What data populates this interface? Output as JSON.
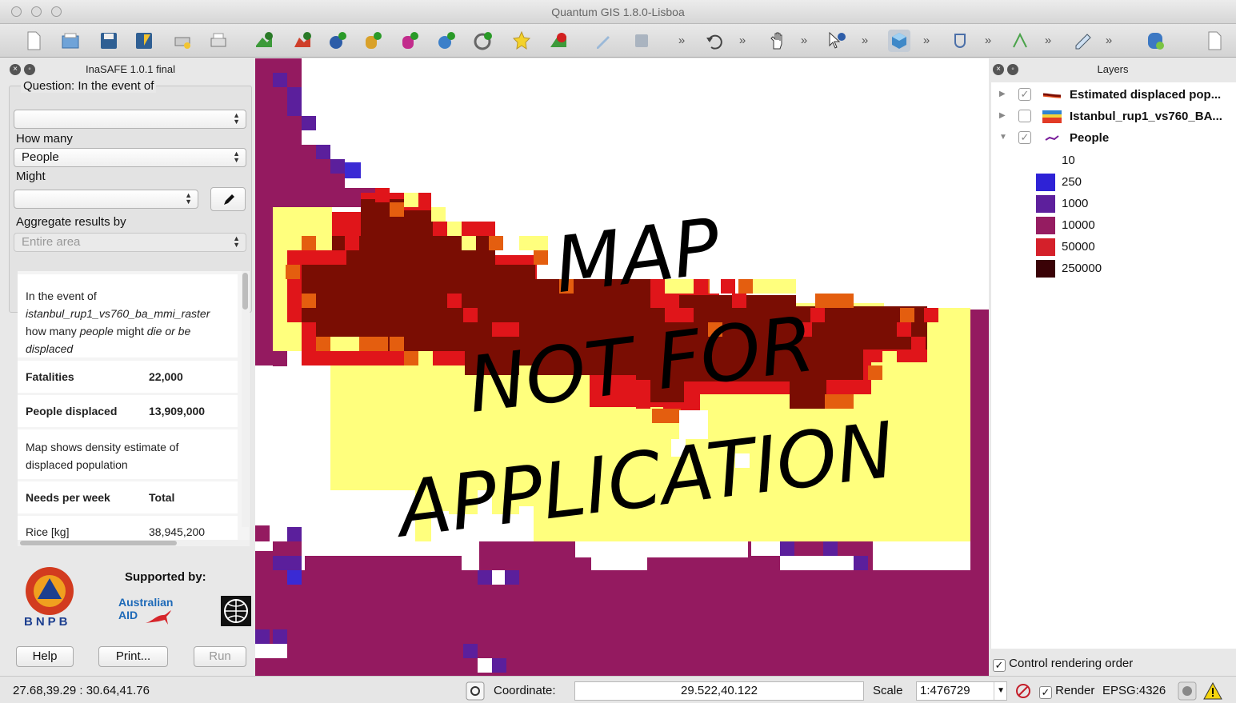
{
  "window": {
    "title": "Quantum GIS 1.8.0-Lisboa"
  },
  "inasafe": {
    "title": "InaSAFE 1.0.1 final",
    "question_label": "Question: In the event of",
    "hazard_value": "",
    "how_many_label": "How many",
    "exposure_value": "People",
    "might_label": "Might",
    "impact_value": "",
    "aggregate_label": "Aggregate results by",
    "aggregate_value": "Entire area",
    "results": {
      "intro_prefix": "In the event of",
      "hazard_name": "istanbul_rup1_vs760_ba_mmi_raster",
      "how_many": "how many",
      "people_word": "people",
      "might": "might",
      "die_or_be": "die or be",
      "displaced": "displaced",
      "rows": [
        {
          "label": "Fatalities",
          "value": "22,000"
        },
        {
          "label": "People displaced",
          "value": "13,909,000"
        }
      ],
      "note": "Map shows density estimate of displaced population",
      "needs_header": "Needs per week",
      "total_header": "Total",
      "needs_rows": [
        {
          "label": "Rice [kg]",
          "value": "38,945,200"
        }
      ]
    },
    "supported_by": "Supported by:",
    "bnpb_label": "BNPB",
    "australian_aid": "Australian AID",
    "buttons": {
      "help": "Help",
      "print": "Print...",
      "run": "Run"
    }
  },
  "map": {
    "watermark": [
      "MAP",
      "NOT FOR",
      "APPLICATION"
    ],
    "colors": {
      "purple": "#941a60",
      "violet": "#5b1f9c",
      "blue": "#3a2ad4",
      "yellow": "#ffff7d",
      "orange": "#e45e0f",
      "red": "#e0151a",
      "maroon": "#7a0d03"
    }
  },
  "layers": {
    "title": "Layers",
    "items": [
      {
        "name": "Estimated displaced pop...",
        "checked": true,
        "expanded": false,
        "icon": "polygon-layer-icon"
      },
      {
        "name": "Istanbul_rup1_vs760_BA...",
        "checked": false,
        "expanded": false,
        "icon": "raster-layer-icon"
      },
      {
        "name": "People",
        "checked": true,
        "expanded": true,
        "icon": "raster-layer-icon"
      }
    ],
    "legend": [
      {
        "label": "10",
        "color": "#ffffff"
      },
      {
        "label": "250",
        "color": "#2e22d6"
      },
      {
        "label": "1000",
        "color": "#5d1f9c"
      },
      {
        "label": "10000",
        "color": "#951c61"
      },
      {
        "label": "50000",
        "color": "#d4202a"
      },
      {
        "label": "250000",
        "color": "#3a0206"
      }
    ],
    "control_rendering_order": "Control rendering order"
  },
  "statusbar": {
    "extent": "27.68,39.29 : 30.64,41.76",
    "coordinate_label": "Coordinate:",
    "coordinate_value": "29.522,40.122",
    "scale_label": "Scale",
    "scale_value": "1:476729",
    "render_label": "Render",
    "crs": "EPSG:4326"
  }
}
